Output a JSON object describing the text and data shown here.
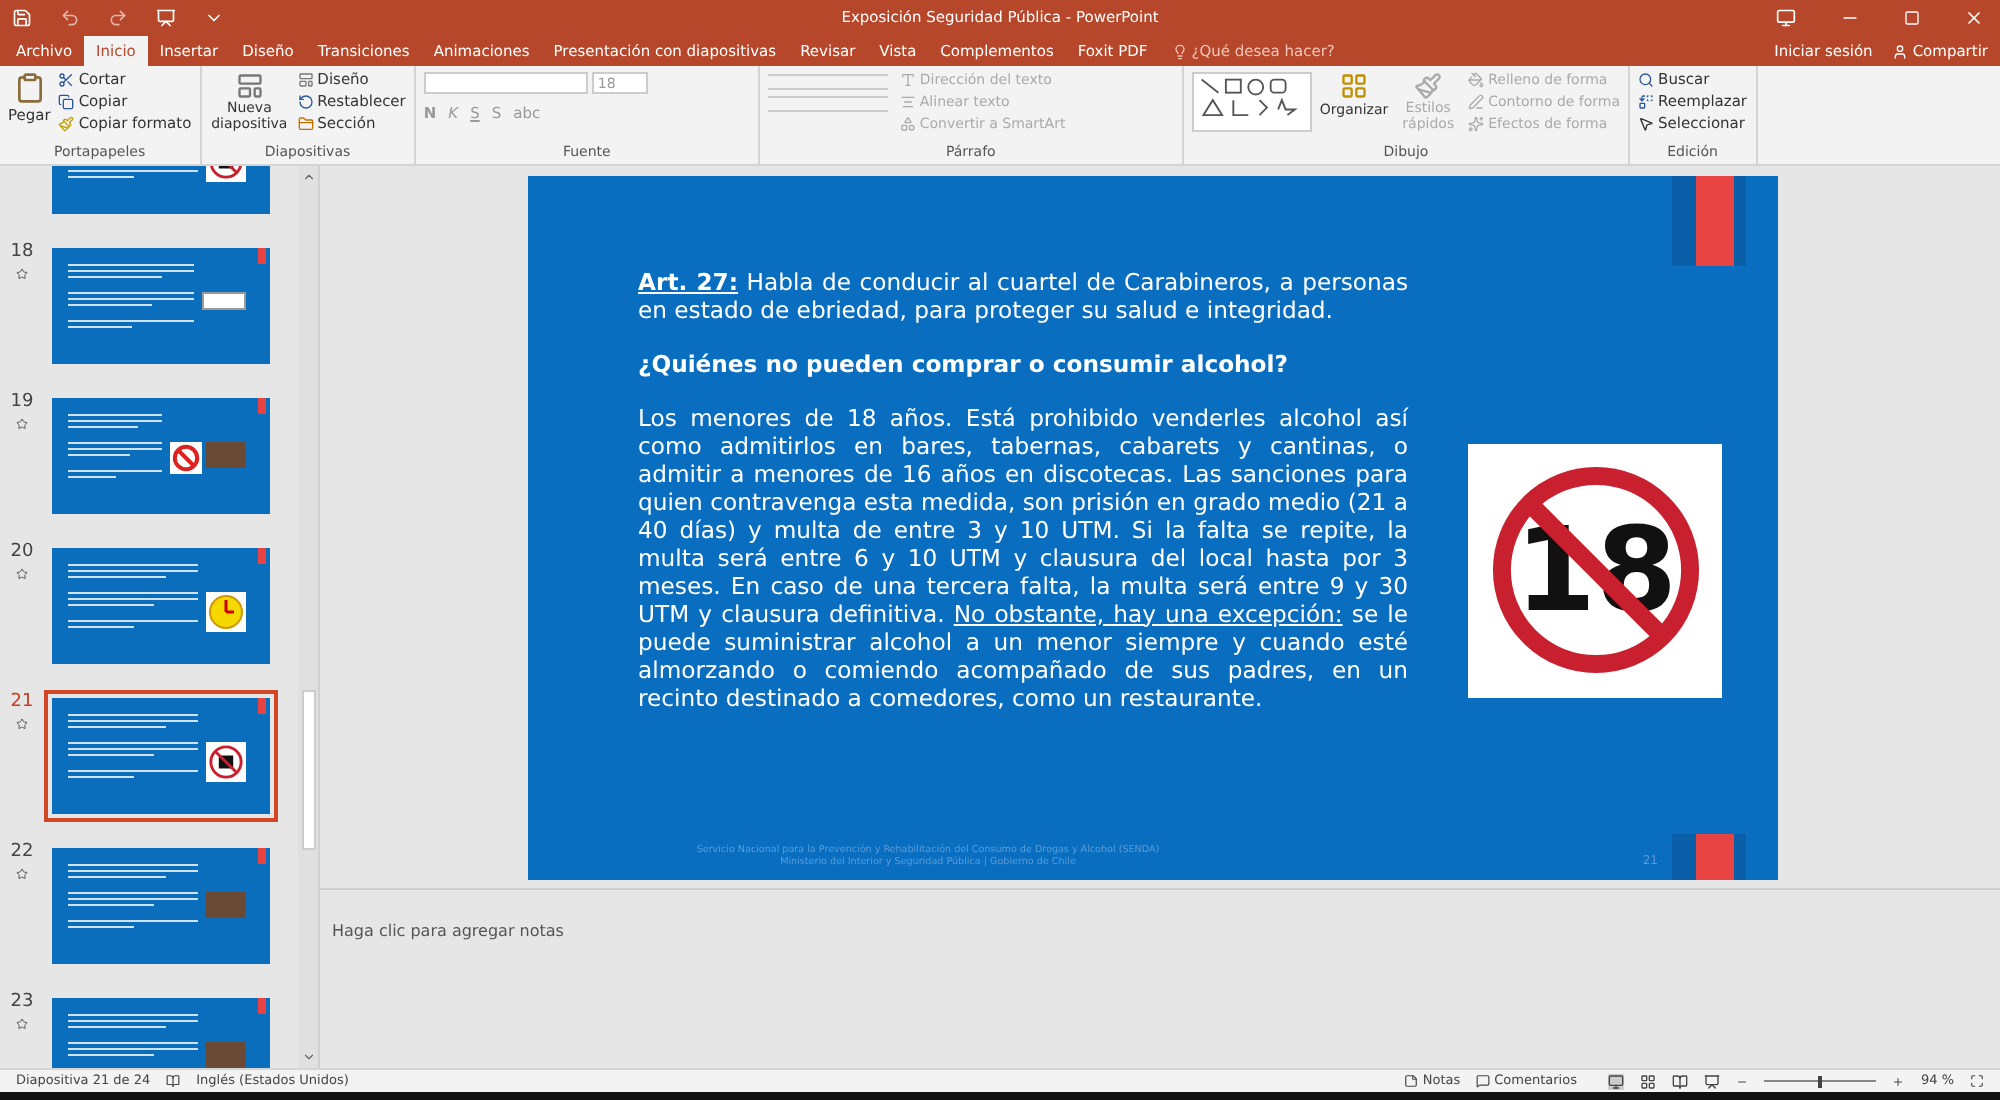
{
  "title_bar": {
    "title": "Exposición Seguridad Pública - PowerPoint"
  },
  "tabs": [
    {
      "label": "Archivo",
      "selected": false
    },
    {
      "label": "Inicio",
      "selected": true
    },
    {
      "label": "Insertar",
      "selected": false
    },
    {
      "label": "Diseño",
      "selected": false
    },
    {
      "label": "Transiciones",
      "selected": false
    },
    {
      "label": "Animaciones",
      "selected": false
    },
    {
      "label": "Presentación con diapositivas",
      "selected": false
    },
    {
      "label": "Revisar",
      "selected": false
    },
    {
      "label": "Vista",
      "selected": false
    },
    {
      "label": "Complementos",
      "selected": false
    },
    {
      "label": "Foxit PDF",
      "selected": false
    }
  ],
  "tell_me": "¿Qué desea hacer?",
  "account": {
    "sign_in": "Iniciar sesión",
    "share": "Compartir"
  },
  "ribbon": {
    "clipboard": {
      "paste": "Pegar",
      "cut": "Cortar",
      "copy": "Copiar",
      "format_painter": "Copiar formato",
      "label": "Portapapeles"
    },
    "slides": {
      "new_slide": "Nueva diapositiva",
      "layout": "Diseño",
      "reset": "Restablecer",
      "section": "Sección",
      "label": "Diapositivas"
    },
    "font": {
      "size": "18",
      "format_buttons": [
        "N",
        "K",
        "S",
        "S",
        "abc"
      ],
      "label": "Fuente"
    },
    "paragraph": {
      "commands": [
        "Dirección del texto",
        "Alinear texto",
        "Convertir a SmartArt"
      ],
      "label": "Párrafo"
    },
    "drawing": {
      "arrange": "Organizar",
      "quick_styles": "Estilos rápidos",
      "commands": [
        "Relleno de forma",
        "Contorno de forma",
        "Efectos de forma"
      ],
      "label": "Dibujo"
    },
    "editing": {
      "find": "Buscar",
      "replace": "Reemplazar",
      "select": "Seleccionar",
      "label": "Edición"
    }
  },
  "thumbnails": [
    {
      "selected": false,
      "images": [
        {
          "kind": "no18"
        }
      ]
    },
    {
      "number": "18",
      "selected": false,
      "images": [
        {
          "kind": "badge"
        }
      ]
    },
    {
      "number": "19",
      "selected": false,
      "images": [
        {
          "kind": "prohibited"
        },
        {
          "kind": "photo"
        }
      ]
    },
    {
      "number": "20",
      "selected": false,
      "images": [
        {
          "kind": "clock"
        }
      ]
    },
    {
      "number": "21",
      "selected": true,
      "images": [
        {
          "kind": "no18"
        }
      ]
    },
    {
      "number": "22",
      "selected": false,
      "images": [
        {
          "kind": "photo"
        }
      ]
    },
    {
      "number": "23",
      "selected": false,
      "images": [
        {
          "kind": "photo"
        }
      ]
    }
  ],
  "slide": {
    "paragraphs": [
      {
        "kind": "text",
        "runs": [
          {
            "text": "Art. 27:",
            "bold": true,
            "underline": true
          },
          {
            "text": " Habla de conducir al cuartel de Carabineros, a personas en estado de ebriedad, para proteger su salud e integridad."
          }
        ]
      },
      {
        "kind": "heading",
        "runs": [
          {
            "text": "¿Quiénes no pueden comprar o consumir alcohol?"
          }
        ]
      },
      {
        "kind": "text",
        "runs": [
          {
            "text": "Los menores de 18 años. Está prohibido venderles alcohol así como admitirlos en bares, tabernas, cabarets y cantinas, o admitir a menores de 16 años en discotecas. Las sanciones para quien contravenga esta medida, son prisión en grado medio (21 a 40 días) y multa de entre 3 y 10 UTM. Si la falta se repite, la multa será entre 6 y 10 UTM y clausura del local hasta por 3 meses. En caso de una tercera falta, la multa será entre 9 y 30 UTM y clausura definitiva. "
          },
          {
            "text": "No obstante, hay una excepción:",
            "underline": true
          },
          {
            "text": " se le puede suministrar alcohol a un menor siempre y cuando esté almorzando o comiendo acompañado de sus padres, en un recinto destinado a comedores, como un restaurante."
          }
        ]
      }
    ],
    "sign_text": "18",
    "footer": [
      "Servicio Nacional para la Prevención y Rehabilitación del Consumo de Drogas y Alcohol (SENDA)",
      "Ministerio del Interior y Seguridad Pública | Gobierno de Chile"
    ],
    "page_number": "21"
  },
  "notes_placeholder": "Haga clic para agregar notas",
  "status_bar": {
    "slide_info": "Diapositiva 21 de 24",
    "language": "Inglés (Estados Unidos)",
    "notes": "Notas",
    "comments": "Comentarios",
    "zoom": "94 %",
    "zoom_level": {
      "level": 0.47
    }
  }
}
